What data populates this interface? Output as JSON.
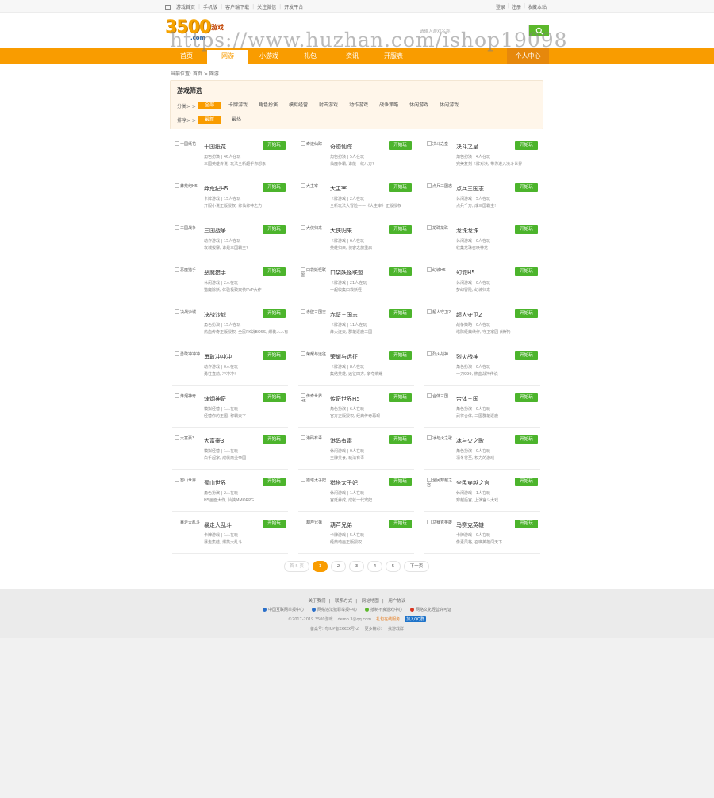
{
  "topbar": {
    "links": [
      "游戏首页",
      "手机版",
      "客户端下载",
      "关注微信",
      "开发平台"
    ],
    "user": [
      "登录",
      "注册",
      "收藏本站"
    ]
  },
  "logo": {
    "number": "3500",
    "text": "游戏",
    "domain": ".com"
  },
  "search": {
    "placeholder": "请输入游戏名称",
    "icon": "search-icon"
  },
  "watermark": "https://www.huzhan.com/ishop19098",
  "nav": {
    "items": [
      "首页",
      "网游",
      "小游戏",
      "礼包",
      "资讯",
      "开服表"
    ],
    "active_index": 1,
    "user_center": "个人中心"
  },
  "breadcrumb": "当前位置: 首页 > 网游",
  "filter": {
    "title": "游戏筛选",
    "category_label": "分类> >",
    "categories": [
      "全部",
      "卡牌游戏",
      "角色扮演",
      "模拟经营",
      "射击游戏",
      "动作游戏",
      "战争策略",
      "休闲游戏",
      "休闲游戏"
    ],
    "sort_label": "排序> >",
    "sorts": [
      "最新",
      "最热"
    ]
  },
  "play_label": "开始玩",
  "games": [
    {
      "name": "十国纸花",
      "thumb": "十国纸花",
      "meta": "角色扮演 | 46人在玩",
      "desc": "三国英雄传说, 玩法全新超乎你想象"
    },
    {
      "name": "奇迹仙踪",
      "thumb": "奇迹仙踪",
      "meta": "角色扮演 | 5人在玩",
      "desc": "仙魔争霸, 谁能一统八方?"
    },
    {
      "name": "决斗之皇",
      "thumb": "决斗之皇",
      "meta": "角色扮演 | 4人在玩",
      "desc": "完美复刻卡牌对决, 带你进入决斗世界"
    },
    {
      "name": "莽荒纪H5",
      "thumb": "莽荒纪H5",
      "meta": "卡牌游戏 | 15人在玩",
      "desc": "开服小说正版授权, 修仙修神之力"
    },
    {
      "name": "大主宰",
      "thumb": "大主宰",
      "meta": "卡牌游戏 | 2人在玩",
      "desc": "全新玩法大冒险——《大主宰》正版授权"
    },
    {
      "name": "点兵三国志",
      "thumb": "点兵三国志",
      "meta": "休闲游戏 | 5人在玩",
      "desc": "点兵千万, 成三国霸主!"
    },
    {
      "name": "三国战争",
      "thumb": "三国战争",
      "meta": "动作游戏 | 15人在玩",
      "desc": "攻城拔寨, 谁是三国霸主?"
    },
    {
      "name": "大侠归来",
      "thumb": "大侠归来",
      "meta": "卡牌游戏 | 6人在玩",
      "desc": "英雄归来, 侠客之旅重启"
    },
    {
      "name": "龙珠龙珠",
      "thumb": "龙珠龙珠",
      "meta": "休闲游戏 | 0人在玩",
      "desc": "收集龙珠召唤神龙"
    },
    {
      "name": "恶魔猎手",
      "thumb": "恶魔猎手",
      "meta": "休闲游戏 | 2人在玩",
      "desc": "猎魔除妖, 体验极致爽快PVP大作"
    },
    {
      "name": "口袋妖怪联盟",
      "thumb": "口袋妖怪联盟",
      "meta": "卡牌游戏 | 21人在玩",
      "desc": "一起收集口袋妖怪"
    },
    {
      "name": "幻城H5",
      "thumb": "幻城H5",
      "meta": "休闲游戏 | 0人在玩",
      "desc": "梦幻冒险, 幻城归来"
    },
    {
      "name": "决战沙城",
      "thumb": "决战沙城",
      "meta": "角色扮演 | 15人在玩",
      "desc": "热血传奇正版授权, 全民PK战BOSS, 爆装人人有"
    },
    {
      "name": "赤壁三国志",
      "thumb": "赤壁三国志",
      "meta": "卡牌游戏 | 11人在玩",
      "desc": "烽火连天, 群雄逐鹿三国"
    },
    {
      "name": "超人守卫2",
      "thumb": "超人守卫2",
      "meta": "战争策略 | 0人在玩",
      "desc": "塔防经典续作, 守卫家园 (续作)"
    },
    {
      "name": "勇敢冲冲冲",
      "thumb": "勇敢冲冲冲",
      "meta": "动作游戏 | 0人在玩",
      "desc": "勇往直前, 冲冲冲!"
    },
    {
      "name": "荣耀与远征",
      "thumb": "荣耀与远征",
      "meta": "卡牌游戏 | 8人在玩",
      "desc": "集结英雄, 远征四方, 争夺荣耀"
    },
    {
      "name": "烈火战神",
      "thumb": "烈火战神",
      "meta": "角色扮演 | 0人在玩",
      "desc": "一刀999, 热血战神传说"
    },
    {
      "name": "烽烟神奇",
      "thumb": "烽烟神奇",
      "meta": "模拟经营 | 1人在玩",
      "desc": "经营你的王国, 称霸天下"
    },
    {
      "name": "传奇世界H5",
      "thumb": "传奇世界H5",
      "meta": "角色扮演 | 6人在玩",
      "desc": "官方正版授权, 经典传奇再现"
    },
    {
      "name": "合体三国",
      "thumb": "合体三国",
      "meta": "角色扮演 | 0人在玩",
      "desc": "武将合体, 三国群雄逐鹿"
    },
    {
      "name": "大富豪3",
      "thumb": "大富豪3",
      "meta": "模拟经营 | 1人在玩",
      "desc": "白手起家, 成就商业帝国"
    },
    {
      "name": "港码有毒",
      "thumb": "港码有毒",
      "meta": "休闲游戏 | 0人在玩",
      "desc": "王牌美食, 玩法有毒"
    },
    {
      "name": "冰与火之歌",
      "thumb": "冰与火之歌",
      "meta": "角色扮演 | 0人在玩",
      "desc": "凛冬将至, 权力的游戏"
    },
    {
      "name": "蜀山世界",
      "thumb": "蜀山世界",
      "meta": "角色扮演 | 2人在玩",
      "desc": "H5画面大作, 仙侠MMORPG"
    },
    {
      "name": "猎塔太子妃",
      "thumb": "猎塔太子妃",
      "meta": "休闲游戏 | 1人在玩",
      "desc": "宫廷养成, 成就一代宠妃"
    },
    {
      "name": "全民穿越之宫",
      "thumb": "全民穿越之宫",
      "meta": "休闲游戏 | 1人在玩",
      "desc": "穿越后宫, 上演宫斗大戏"
    },
    {
      "name": "暴走大乱斗",
      "thumb": "暴走大乱斗",
      "meta": "卡牌游戏 | 1人在玩",
      "desc": "暴走集结, 爆笑大乱斗"
    },
    {
      "name": "葫芦兄弟",
      "thumb": "葫芦兄弟",
      "meta": "卡牌游戏 | 5人在玩",
      "desc": "经典动画正版授权"
    },
    {
      "name": "马赛克英雄",
      "thumb": "马赛克英雄",
      "meta": "卡牌游戏 | 0人在玩",
      "desc": "像素风格, 召唤英雄闯天下"
    }
  ],
  "pager": {
    "prev": "首 5 页",
    "pages": [
      "1",
      "2",
      "3",
      "4",
      "5"
    ],
    "current": "1",
    "next": "下一页"
  },
  "footer": {
    "links": [
      "关于我们",
      "联系方式",
      "网站地图",
      "用户协议"
    ],
    "badges": [
      {
        "text": "中国互联网举报中心",
        "color": "#2a6fc9"
      },
      {
        "text": "网络违法犯罪举报中心",
        "color": "#2a6fc9"
      },
      {
        "text": "抵制不良游戏中心",
        "color": "#5cb82b"
      },
      {
        "text": "网络文化经营许可证",
        "color": "#d9341f"
      }
    ],
    "copyright": "©2017-2019  3500游戏",
    "email": "demo.3@qq.com",
    "highlight": "礼包在线服务",
    "qq": "加入QQ群",
    "icp_items": [
      "备案号: 粤ICP备xxxxx号-2",
      "更多精彩:",
      "找游戏群"
    ]
  }
}
